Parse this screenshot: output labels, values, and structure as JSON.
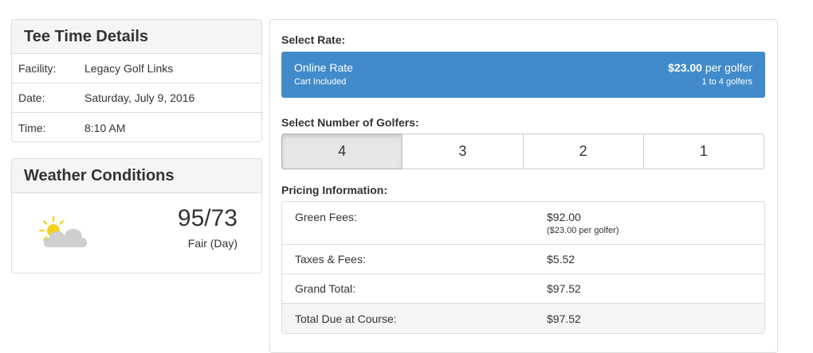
{
  "tee_time": {
    "title": "Tee Time Details",
    "rows": [
      {
        "label": "Facility:",
        "value": "Legacy Golf Links"
      },
      {
        "label": "Date:",
        "value": "Saturday, July 9, 2016"
      },
      {
        "label": "Time:",
        "value": "8:10 AM"
      }
    ]
  },
  "weather": {
    "title": "Weather Conditions",
    "icon": "partly-sunny-icon",
    "temperature": "95/73",
    "condition": "Fair (Day)"
  },
  "rate": {
    "section_label": "Select Rate:",
    "name": "Online Rate",
    "subtitle": "Cart Included",
    "price": "$23.00",
    "price_unit": " per golfer",
    "range": "1 to 4 golfers",
    "color": "#428bca"
  },
  "golfers": {
    "section_label": "Select Number of Golfers:",
    "options": [
      "4",
      "3",
      "2",
      "1"
    ],
    "selected": "4"
  },
  "pricing": {
    "section_label": "Pricing Information:",
    "green_fees": {
      "label": "Green Fees:",
      "value": "$92.00",
      "sub": "($23.00 per golfer)"
    },
    "taxes": {
      "label": "Taxes & Fees:",
      "value": "$5.52"
    },
    "grand_total": {
      "label": "Grand Total:",
      "value": "$97.52"
    },
    "due_at_course": {
      "label": "Total Due at Course:",
      "value": "$97.52"
    }
  }
}
